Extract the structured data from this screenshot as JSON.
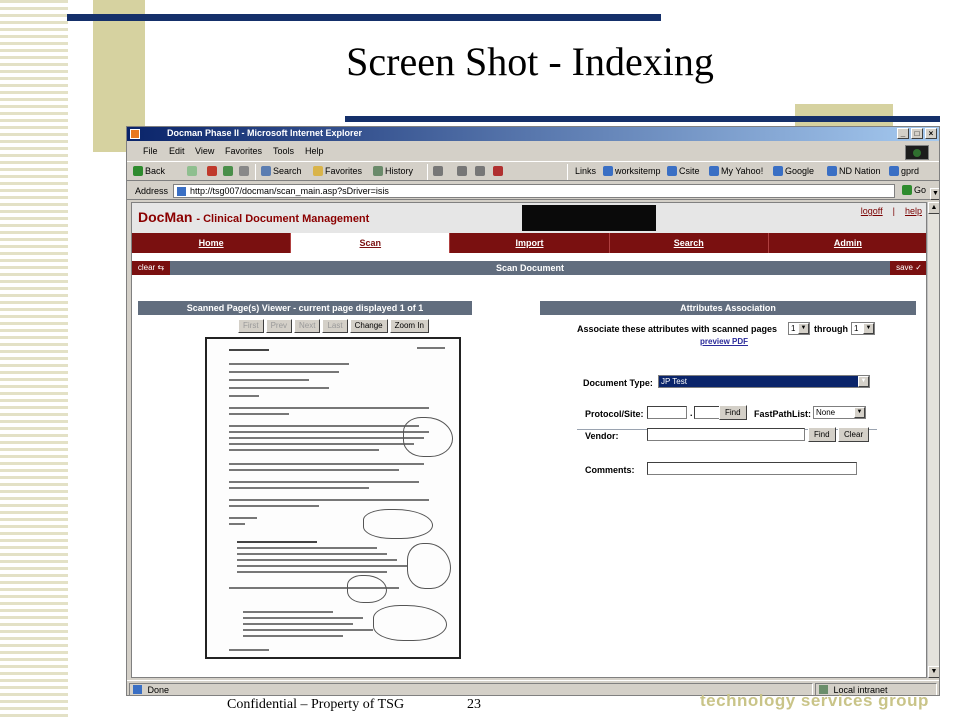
{
  "slide": {
    "title": "Screen Shot - Indexing",
    "footer": "Confidential – Property of TSG",
    "page_number": "23",
    "footer_logo": "technology services group"
  },
  "browser": {
    "window_title": "Docman Phase II - Microsoft Internet Explorer",
    "menu": [
      "File",
      "Edit",
      "View",
      "Favorites",
      "Tools",
      "Help"
    ],
    "toolbar": {
      "back": "Back",
      "search": "Search",
      "favorites": "Favorites",
      "history": "History",
      "links_label": "Links",
      "links": [
        "worksitemp",
        "Csite",
        "My Yahoo!",
        "Google",
        "ND Nation",
        "gprd"
      ]
    },
    "address_label": "Address",
    "address_url": "http://tsg007/docman/scan_main.asp?sDriver=isis",
    "go_label": "Go",
    "status_text": "Done",
    "zone_text": "Local intranet"
  },
  "app": {
    "logo": "DocMan",
    "logo_subtitle": "- Clinical Document Management",
    "header_links": [
      "logoff",
      "|",
      "help"
    ],
    "nav_tabs": [
      "Home",
      "Scan",
      "Import",
      "Search",
      "Admin"
    ],
    "active_tab": "Scan",
    "section_title": "Scan Document",
    "clear_label": "clear",
    "save_label": "save"
  },
  "viewer": {
    "header": "Scanned Page(s) Viewer - current page displayed 1 of 1",
    "buttons": {
      "first": "First",
      "prev": "Prev",
      "next": "Next",
      "last": "Last",
      "change": "Change",
      "zoom_in": "Zoom In"
    }
  },
  "attributes": {
    "header": "Attributes Association",
    "associate_label": "Associate these attributes with scanned pages",
    "from_page": "1",
    "through_label": "through",
    "to_page": "1",
    "preview_link": "preview PDF",
    "document_type_label": "Document Type:",
    "document_type_value": "JP Test",
    "protocol_label": "Protocol/Site:",
    "protocol_separator": ".",
    "find_label": "Find",
    "fastpath_label": "FastPathList:",
    "fastpath_value": "None",
    "vendor_label": "Vendor:",
    "clear_label": "Clear",
    "comments_label": "Comments:"
  },
  "colors": {
    "navy": "#15306a",
    "olive": "#d6d2a0",
    "docman_red": "#7a1010",
    "panel_slate": "#616d7e"
  }
}
